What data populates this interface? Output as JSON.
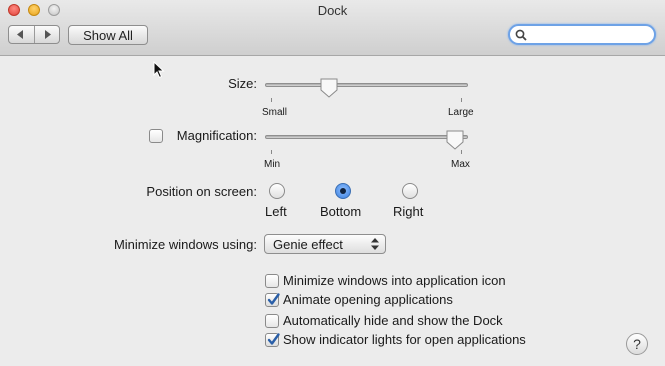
{
  "window": {
    "title": "Dock"
  },
  "toolbar": {
    "back_icon": "chevron-left-icon",
    "forward_icon": "chevron-right-icon",
    "show_all_label": "Show All",
    "search": {
      "value": "",
      "placeholder": ""
    }
  },
  "size": {
    "label": "Size:",
    "min_label": "Small",
    "max_label": "Large",
    "value_fraction": 0.3
  },
  "magnification": {
    "label": "Magnification:",
    "checked": false,
    "min_label": "Min",
    "max_label": "Max",
    "value_fraction": 0.97
  },
  "position": {
    "label": "Position on screen:",
    "options": [
      "Left",
      "Bottom",
      "Right"
    ],
    "selected": "Bottom"
  },
  "minimize": {
    "label": "Minimize windows using:",
    "value": "Genie effect"
  },
  "checkboxes": [
    {
      "label": "Minimize windows into application icon",
      "checked": false
    },
    {
      "label": "Animate opening applications",
      "checked": true
    },
    {
      "label": "Automatically hide and show the Dock",
      "checked": false
    },
    {
      "label": "Show indicator lights for open applications",
      "checked": true
    }
  ],
  "help": {
    "label": "?"
  },
  "colors": {
    "accent": "#3a7ede",
    "background": "#ececec",
    "focus_ring": "#6ea2e6"
  }
}
